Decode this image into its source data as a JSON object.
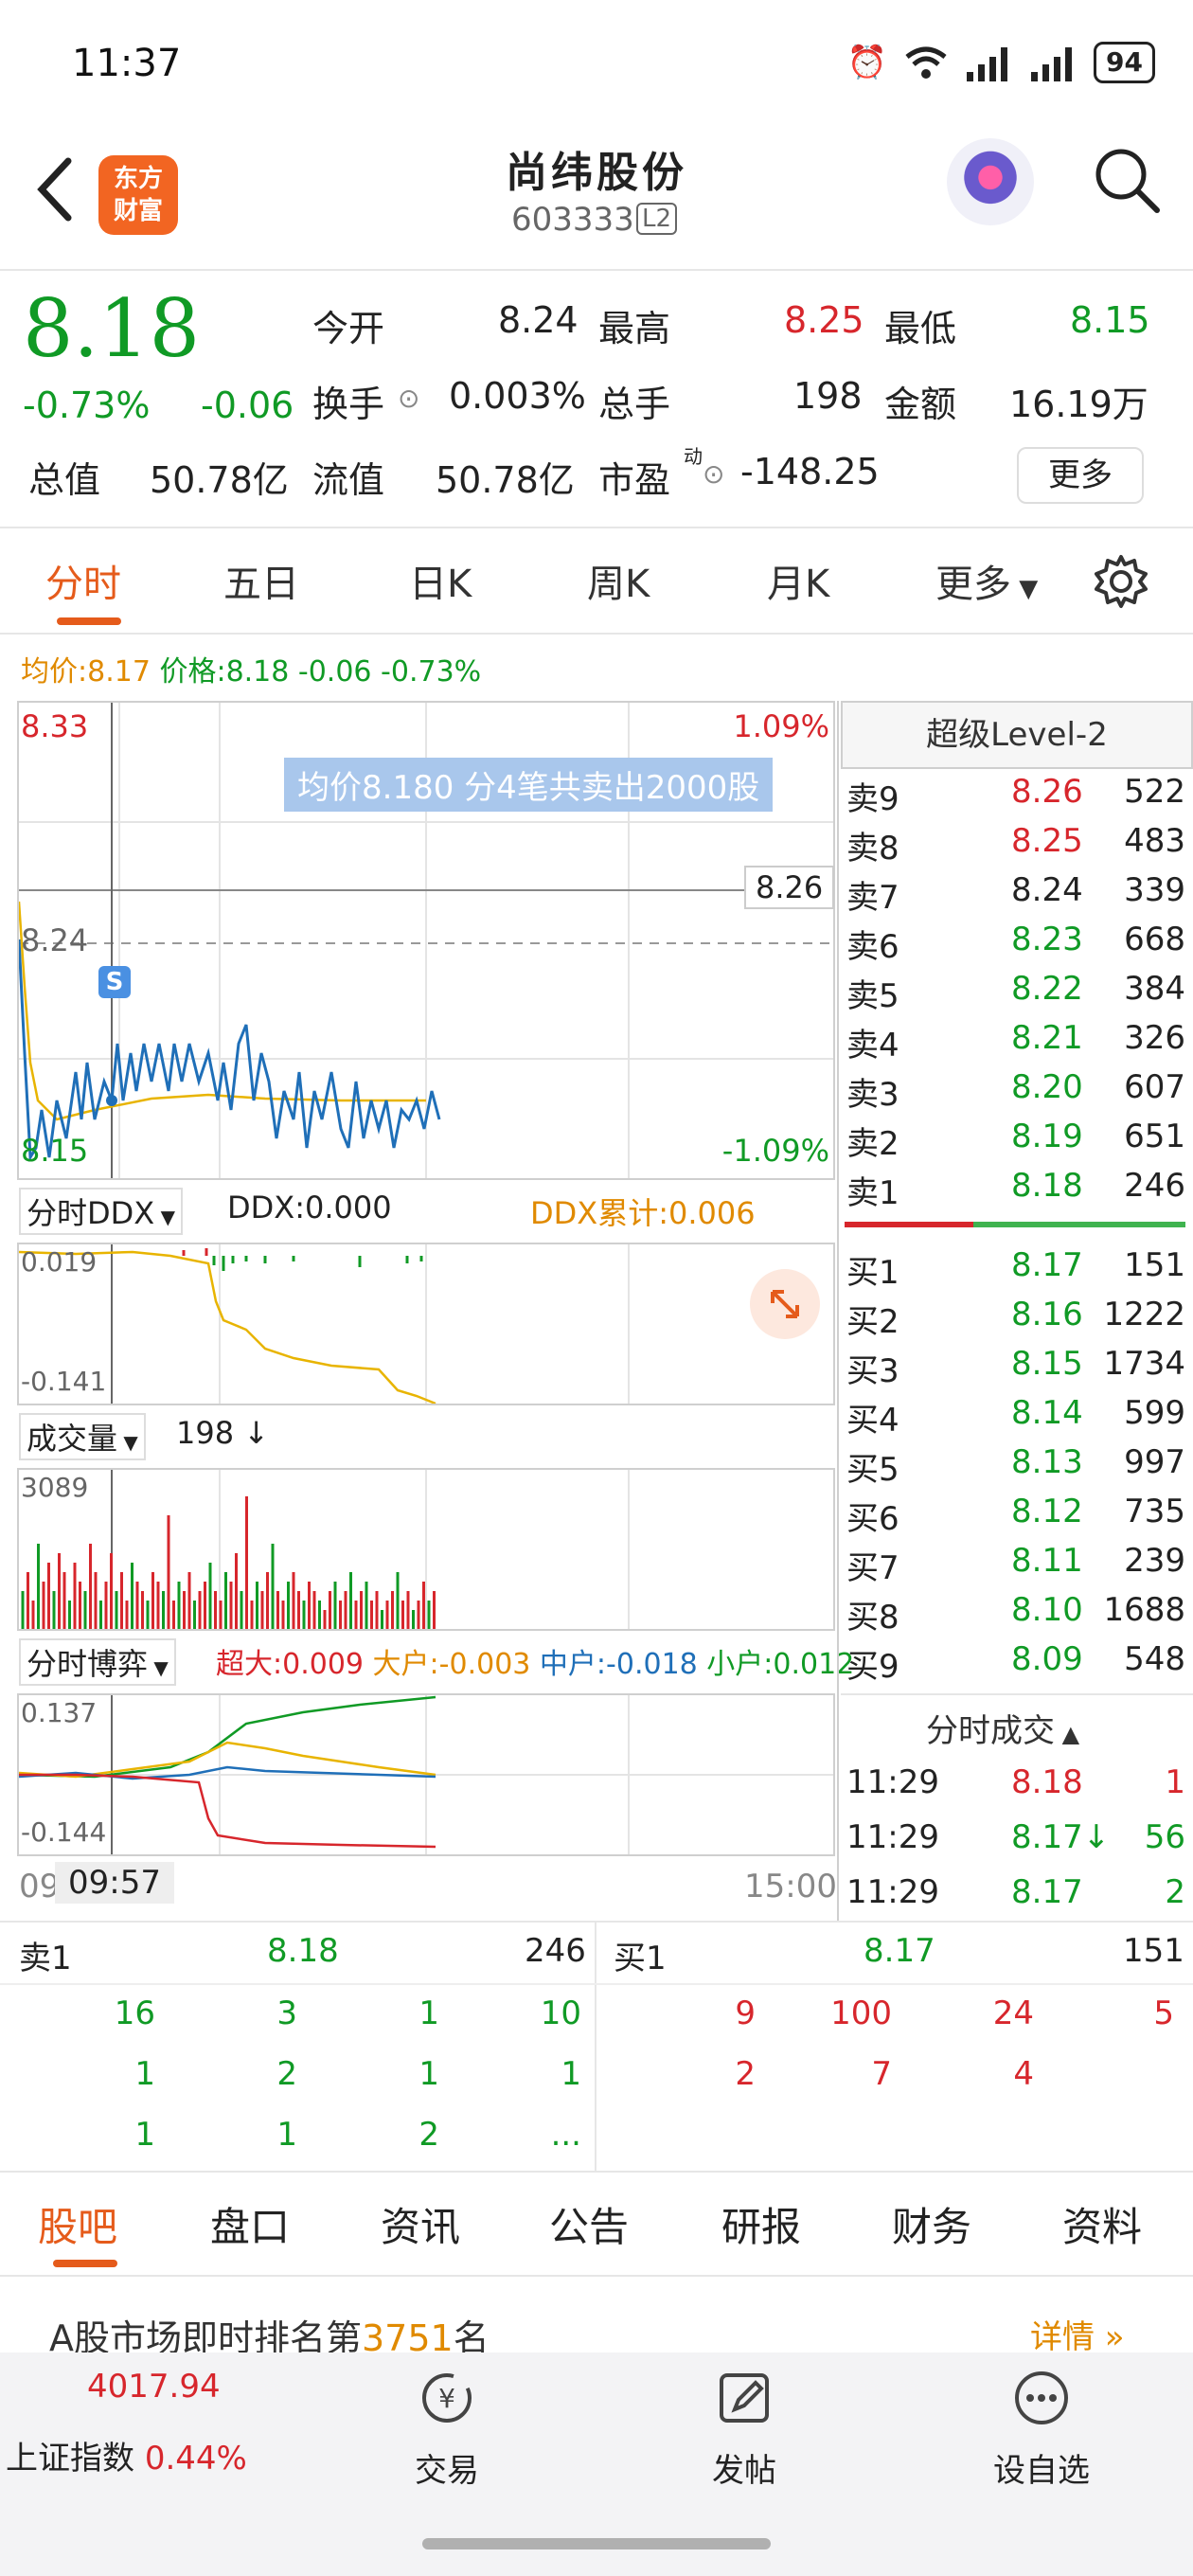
{
  "status": {
    "time": "11:37",
    "battery": "94"
  },
  "header": {
    "logo_line1": "东方",
    "logo_line2": "财富",
    "name": "尚纬股份",
    "code": "603333",
    "level": "L2"
  },
  "quote": {
    "price": "8.18",
    "change_pct": "-0.73%",
    "change": "-0.06",
    "open_label": "今开",
    "open": "8.24",
    "high_label": "最高",
    "high": "8.25",
    "low_label": "最低",
    "low": "8.15",
    "turnover_label": "换手",
    "turnover": "0.003%",
    "volume_label": "总手",
    "volume": "198",
    "amount_label": "金额",
    "amount": "16.19万",
    "mktcap_label": "总值",
    "mktcap": "50.78亿",
    "float_label": "流值",
    "float": "50.78亿",
    "pe_label": "市盈",
    "pe_sup": "动",
    "pe": "-148.25",
    "more": "更多"
  },
  "tabs": [
    "分时",
    "五日",
    "日K",
    "周K",
    "月K",
    "更多"
  ],
  "avg_line": {
    "avg_label": "均价:",
    "avg": "8.17",
    "price_label": "价格:",
    "price": "8.18 -0.06 -0.73%"
  },
  "chart": {
    "top_price": "8.33",
    "top_pct": "1.09%",
    "bottom_price": "8.15",
    "bottom_pct": "-1.09%",
    "mid_price": "8.24",
    "cross_price": "8.26",
    "tooltip": "均价8.180  分4笔共卖出2000股",
    "s_badge": "S",
    "ddx_select": "分时DDX",
    "ddx": "DDX:0.000",
    "ddx_acc": "DDX累计:0.006",
    "ddx_top": "0.019",
    "ddx_bottom": "-0.141",
    "vol_select": "成交量",
    "vol_value": "198",
    "vol_top": "3089",
    "game_select": "分时博弈",
    "game_super": "超大:",
    "game_super_v": "0.009",
    "game_big": "大户:",
    "game_big_v": "-0.003",
    "game_mid": "中户:",
    "game_mid_v": "-0.018",
    "game_small": "小户:",
    "game_small_v": "0.012",
    "game_top": "0.137",
    "game_bottom": "-0.144",
    "time_start": "09",
    "time_cursor": "09:57",
    "time_end": "15:00"
  },
  "orderbook": {
    "title": "超级Level-2",
    "asks": [
      {
        "label": "卖9",
        "price": "8.26",
        "vol": "522",
        "c": "red"
      },
      {
        "label": "卖8",
        "price": "8.25",
        "vol": "483",
        "c": "red"
      },
      {
        "label": "卖7",
        "price": "8.24",
        "vol": "339",
        "c": "black"
      },
      {
        "label": "卖6",
        "price": "8.23",
        "vol": "668",
        "c": "green"
      },
      {
        "label": "卖5",
        "price": "8.22",
        "vol": "384",
        "c": "green"
      },
      {
        "label": "卖4",
        "price": "8.21",
        "vol": "326",
        "c": "green"
      },
      {
        "label": "卖3",
        "price": "8.20",
        "vol": "607",
        "c": "green"
      },
      {
        "label": "卖2",
        "price": "8.19",
        "vol": "651",
        "c": "green"
      },
      {
        "label": "卖1",
        "price": "8.18",
        "vol": "246",
        "c": "green"
      }
    ],
    "bids": [
      {
        "label": "买1",
        "price": "8.17",
        "vol": "151",
        "c": "green"
      },
      {
        "label": "买2",
        "price": "8.16",
        "vol": "1222",
        "c": "green"
      },
      {
        "label": "买3",
        "price": "8.15",
        "vol": "1734",
        "c": "green"
      },
      {
        "label": "买4",
        "price": "8.14",
        "vol": "599",
        "c": "green"
      },
      {
        "label": "买5",
        "price": "8.13",
        "vol": "997",
        "c": "green"
      },
      {
        "label": "买6",
        "price": "8.12",
        "vol": "735",
        "c": "green"
      },
      {
        "label": "买7",
        "price": "8.11",
        "vol": "239",
        "c": "green"
      },
      {
        "label": "买8",
        "price": "8.10",
        "vol": "1688",
        "c": "green"
      },
      {
        "label": "买9",
        "price": "8.09",
        "vol": "548",
        "c": "green"
      }
    ],
    "trades_title": "分时成交",
    "trades": [
      {
        "time": "11:29",
        "price": "8.18",
        "vol": "1",
        "c": "red"
      },
      {
        "time": "11:29",
        "price": "8.17↓",
        "vol": "56",
        "c": "green"
      },
      {
        "time": "11:29",
        "price": "8.17",
        "vol": "2",
        "c": "green"
      }
    ]
  },
  "queue": {
    "sell_label": "卖1",
    "sell_price": "8.18",
    "sell_vol": "246",
    "buy_label": "买1",
    "buy_price": "8.17",
    "buy_vol": "151",
    "sell_rows": [
      [
        "16",
        "3",
        "1",
        "10"
      ],
      [
        "1",
        "2",
        "1",
        "1"
      ],
      [
        "1",
        "1",
        "2",
        "..."
      ]
    ],
    "buy_rows": [
      [
        "9",
        "100",
        "24",
        "5"
      ],
      [
        "2",
        "7",
        "4",
        ""
      ]
    ]
  },
  "bottom_tabs": [
    "股吧",
    "盘口",
    "资讯",
    "公告",
    "研报",
    "财务",
    "资料"
  ],
  "rank": {
    "prefix": "A股市场即时排名第",
    "rank": "3751",
    "suffix": "名",
    "detail": "详情"
  },
  "navbar": {
    "index_value": "4017.94",
    "index_name": "上证指数",
    "index_pct": "0.44%",
    "trade": "交易",
    "post": "发帖",
    "watch": "设自选"
  }
}
